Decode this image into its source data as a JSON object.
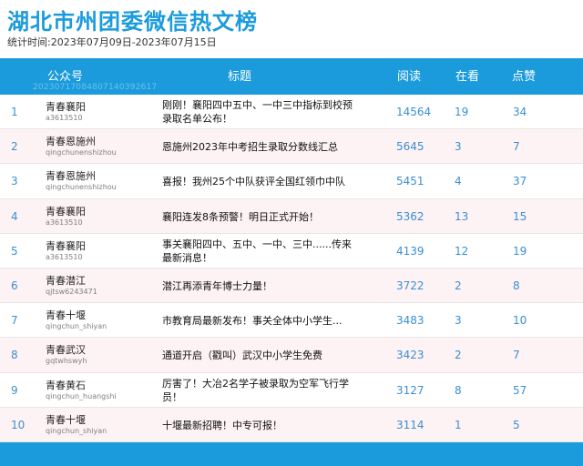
{
  "page": {
    "title": "湖北市州团委微信热文榜",
    "subtitle": "统计时间:2023年07月09日-2023年07月15日"
  },
  "header": {
    "account": "公众号",
    "title": "标题",
    "read": "阅读",
    "looking": "在看",
    "likes": "点赞",
    "watermark": "20230717084807140392617"
  },
  "colors": {
    "accent": "#1b9bdc",
    "alt_row": "#fdf2f4",
    "number": "#3a8fd3"
  },
  "rows": [
    {
      "rank": "1",
      "name": "青春襄阳",
      "id": "a3613510",
      "title": "刚刚！襄阳四中五中、一中三中指标到校预录取名单公布！",
      "read": "14564",
      "looking": "19",
      "likes": "34"
    },
    {
      "rank": "2",
      "name": "青春恩施州",
      "id": "qingchunenshizhou",
      "title": "恩施州2023年中考招生录取分数线汇总",
      "read": "5645",
      "looking": "3",
      "likes": "7"
    },
    {
      "rank": "3",
      "name": "青春恩施州",
      "id": "qingchunenshizhou",
      "title": "喜报！我州25个中队获评全国红领巾中队",
      "read": "5451",
      "looking": "4",
      "likes": "37"
    },
    {
      "rank": "4",
      "name": "青春襄阳",
      "id": "a3613510",
      "title": "襄阳连发8条预警！明日正式开始！",
      "read": "5362",
      "looking": "13",
      "likes": "15"
    },
    {
      "rank": "5",
      "name": "青春襄阳",
      "id": "a3613510",
      "title": "事关襄阳四中、五中、一中、三中......传来最新消息！",
      "read": "4139",
      "looking": "12",
      "likes": "19"
    },
    {
      "rank": "6",
      "name": "青春潜江",
      "id": "qjtsw6243471",
      "title": "潜江再添青年博士力量！",
      "read": "3722",
      "looking": "2",
      "likes": "8"
    },
    {
      "rank": "7",
      "name": "青春十堰",
      "id": "qingchun_shiyan",
      "title": "市教育局最新发布！事关全体中小学生...",
      "read": "3483",
      "looking": "3",
      "likes": "10"
    },
    {
      "rank": "8",
      "name": "青春武汉",
      "id": "gqtwhswyh",
      "title": "通道开启（戳叫）武汉中小学生免费",
      "read": "3423",
      "looking": "2",
      "likes": "7"
    },
    {
      "rank": "9",
      "name": "青春黄石",
      "id": "qingchun_huangshi",
      "title": "厉害了！大冶2名学子被录取为空军飞行学员！",
      "read": "3127",
      "looking": "8",
      "likes": "57"
    },
    {
      "rank": "10",
      "name": "青春十堰",
      "id": "qingchun_shiyan",
      "title": "十堰最新招聘！中专可报！",
      "read": "3114",
      "looking": "1",
      "likes": "5"
    }
  ]
}
